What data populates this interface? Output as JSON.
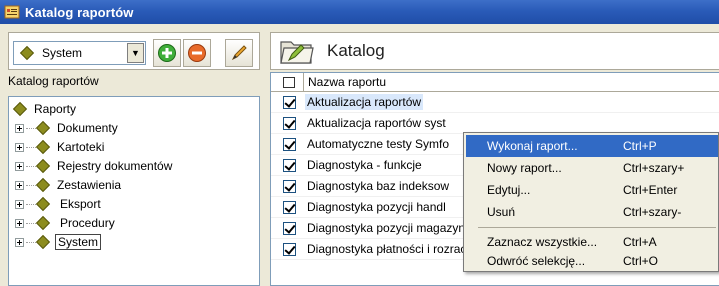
{
  "window": {
    "title": "Katalog raportów"
  },
  "left": {
    "combo_value": "System",
    "tree_label": "Katalog raportów",
    "tree": [
      {
        "label": "Raporty",
        "expandable": false
      },
      {
        "label": "Dokumenty",
        "expandable": true
      },
      {
        "label": "Kartoteki",
        "expandable": true
      },
      {
        "label": "Rejestry dokumentów",
        "expandable": true
      },
      {
        "label": "Zestawienia",
        "expandable": true
      },
      {
        "label": "Eksport",
        "expandable": true
      },
      {
        "label": "Procedury",
        "expandable": true
      },
      {
        "label": "System",
        "expandable": true,
        "selected": true
      }
    ]
  },
  "right": {
    "header_title": "Katalog",
    "column_header": "Nazwa raportu",
    "rows": [
      "Aktualizacja raportów",
      "Aktualizacja raportów syst",
      "Automatyczne testy Symfo",
      "Diagnostyka - funkcje",
      "Diagnostyka baz indeksow",
      "Diagnostyka pozycji handl",
      "Diagnostyka pozycji magazynowych - include",
      "Diagnostyka płatności i rozrachunków - include"
    ]
  },
  "context_menu": {
    "items": [
      {
        "label": "Wykonaj raport...",
        "shortcut": "Ctrl+P"
      },
      {
        "label": "Nowy raport...",
        "shortcut": "Ctrl+szary+"
      },
      {
        "label": "Edytuj...",
        "shortcut": "Ctrl+Enter"
      },
      {
        "label": "Usuń",
        "shortcut": "Ctrl+szary-"
      },
      {
        "label": "Zaznacz wszystkie...",
        "shortcut": "Ctrl+A"
      },
      {
        "label": "Odwróć selekcję...",
        "shortcut": "Ctrl+O"
      }
    ]
  },
  "colors": {
    "titlebar": "#2a5bb8",
    "menu_highlight": "#316ac5",
    "tree_diamond": "#8c8c1e"
  }
}
